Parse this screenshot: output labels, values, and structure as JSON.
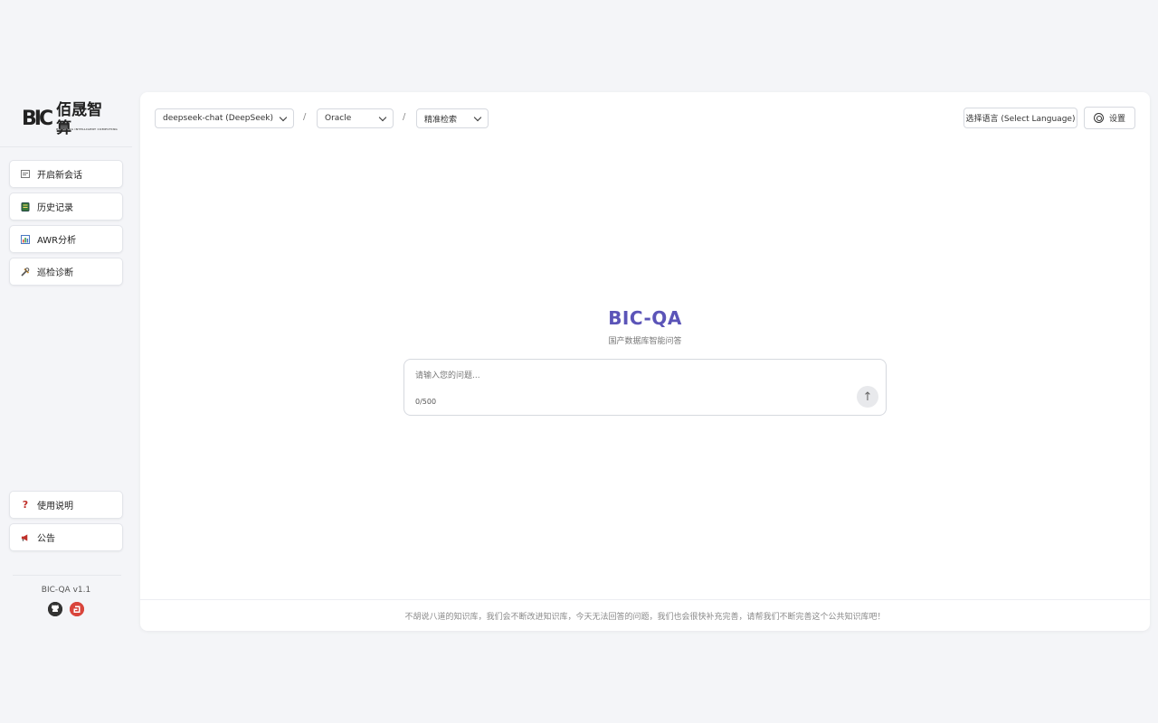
{
  "brand": {
    "logo_mark": "BIC",
    "logo_text": "佰晟智算",
    "logo_subtitle": "BAISHENG INTELLIGENT COMPUTING"
  },
  "sidebar": {
    "items": [
      {
        "label": "开启新会话",
        "icon": "new-chat-icon"
      },
      {
        "label": "历史记录",
        "icon": "history-icon"
      },
      {
        "label": "AWR分析",
        "icon": "chart-icon"
      },
      {
        "label": "巡检诊断",
        "icon": "tools-icon"
      }
    ],
    "bottom_items": [
      {
        "label": "使用说明",
        "icon": "question-icon"
      },
      {
        "label": "公告",
        "icon": "megaphone-icon"
      }
    ],
    "version": "BIC-QA v1.1"
  },
  "toolbar": {
    "model_select": "deepseek-chat (DeepSeek)",
    "db_select": "Oracle",
    "search_mode_select": "精准检索",
    "separator": "/",
    "language_button": "选择语言 (Select Language)",
    "settings_button": "设置"
  },
  "hero": {
    "title": "BIC-QA",
    "subtitle": "国产数据库智能问答"
  },
  "ask": {
    "placeholder": "请输入您的问题...",
    "counter": "0/500",
    "send_glyph": "↑"
  },
  "footer": {
    "text": "不胡说八道的知识库，我们会不断改进知识库，今天无法回答的问题，我们也会很快补充完善，请帮我们不断完善这个公共知识库吧！"
  },
  "colors": {
    "accent": "#5b54b8",
    "background": "#f4f5f8",
    "gitee": "#d9453c"
  }
}
